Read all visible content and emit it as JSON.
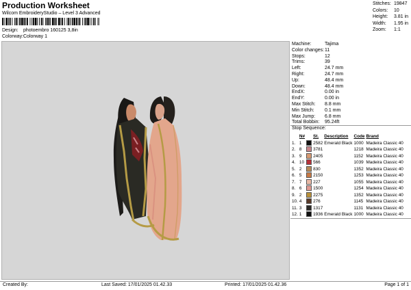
{
  "header": {
    "title": "Production Worksheet",
    "subtitle": "Wilcom EmbroideryStudio – Level 3 Advanced",
    "design_label": "Design:",
    "design_value": "photoembro 160125 3,8in",
    "colorway_label": "Colorway:",
    "colorway_value": "Colorway 1"
  },
  "stats": [
    {
      "label": "Stitches:",
      "value": "19847"
    },
    {
      "label": "Colors:",
      "value": "10"
    },
    {
      "label": "Height:",
      "value": "3.81 in"
    },
    {
      "label": "Width:",
      "value": "1.95 in"
    },
    {
      "label": "Zoom:",
      "value": "1:1"
    }
  ],
  "machine_info": [
    {
      "label": "Machine:",
      "value": "Tajima"
    },
    {
      "label": "Color changes:",
      "value": "11"
    },
    {
      "label": "Stops:",
      "value": "12"
    },
    {
      "label": "Trims:",
      "value": "39"
    },
    {
      "label": "Left:",
      "value": "24.7 mm"
    },
    {
      "label": "Right:",
      "value": "24.7 mm"
    },
    {
      "label": "Up:",
      "value": "48.4 mm"
    },
    {
      "label": "Down:",
      "value": "48.4 mm"
    },
    {
      "label": "EndX:",
      "value": "0.00 in"
    },
    {
      "label": "EndY:",
      "value": "0.00 in"
    },
    {
      "label": "Max Stitch:",
      "value": "8.8 mm"
    },
    {
      "label": "Min Stitch:",
      "value": "0.1 mm"
    },
    {
      "label": "Max Jump:",
      "value": "6.8 mm"
    },
    {
      "label": "Total Bobbin:",
      "value": "95.24ft"
    }
  ],
  "stop_sequence": {
    "title": "Stop Sequence:",
    "headers": [
      "",
      "N#",
      "",
      "St.",
      "Description",
      "Code",
      "Brand"
    ],
    "rows": [
      {
        "idx": "1.",
        "n": "1",
        "color": "#111111",
        "st": "2582",
        "desc": "Emerald Black",
        "code": "1000",
        "brand": "Madeira Classic 40"
      },
      {
        "idx": "2.",
        "n": "8",
        "color": "#c9848a",
        "st": "3781",
        "desc": "",
        "code": "1218",
        "brand": "Madeira Classic 40"
      },
      {
        "idx": "3.",
        "n": "9",
        "color": "#d89a72",
        "st": "2405",
        "desc": "",
        "code": "1152",
        "brand": "Madeira Classic 40"
      },
      {
        "idx": "4.",
        "n": "10",
        "color": "#b8323a",
        "st": "566",
        "desc": "",
        "code": "1039",
        "brand": "Madeira Classic 40"
      },
      {
        "idx": "5.",
        "n": "2",
        "color": "#b78a57",
        "st": "830",
        "desc": "",
        "code": "1352",
        "brand": "Madeira Classic 40"
      },
      {
        "idx": "6.",
        "n": "5",
        "color": "#c87a46",
        "st": "2150",
        "desc": "",
        "code": "1253",
        "brand": "Madeira Classic 40"
      },
      {
        "idx": "7.",
        "n": "7",
        "color": "#e8b9a6",
        "st": "227",
        "desc": "",
        "code": "1055",
        "brand": "Madeira Classic 40"
      },
      {
        "idx": "8.",
        "n": "6",
        "color": "#e09a92",
        "st": "1500",
        "desc": "",
        "code": "1254",
        "brand": "Madeira Classic 40"
      },
      {
        "idx": "9.",
        "n": "2",
        "color": "#b9913a",
        "st": "2275",
        "desc": "",
        "code": "1352",
        "brand": "Madeira Classic 40"
      },
      {
        "idx": "10.",
        "n": "4",
        "color": "#5a3b2a",
        "st": "276",
        "desc": "",
        "code": "1145",
        "brand": "Madeira Classic 40"
      },
      {
        "idx": "11.",
        "n": "3",
        "color": "#2c2a27",
        "st": "1317",
        "desc": "",
        "code": "1131",
        "brand": "Madeira Classic 40"
      },
      {
        "idx": "12.",
        "n": "1",
        "color": "#111111",
        "st": "1936",
        "desc": "Emerald Black",
        "code": "1000",
        "brand": "Madeira Classic 40"
      }
    ]
  },
  "footer": {
    "created_by": "Created By:",
    "last_saved": "Last Saved: 17/01/2025 01.42.33",
    "printed": "Printed: 17/01/2025 01.42.36",
    "page": "Page 1 of 1"
  },
  "icons": [
    "barcode-icon"
  ]
}
